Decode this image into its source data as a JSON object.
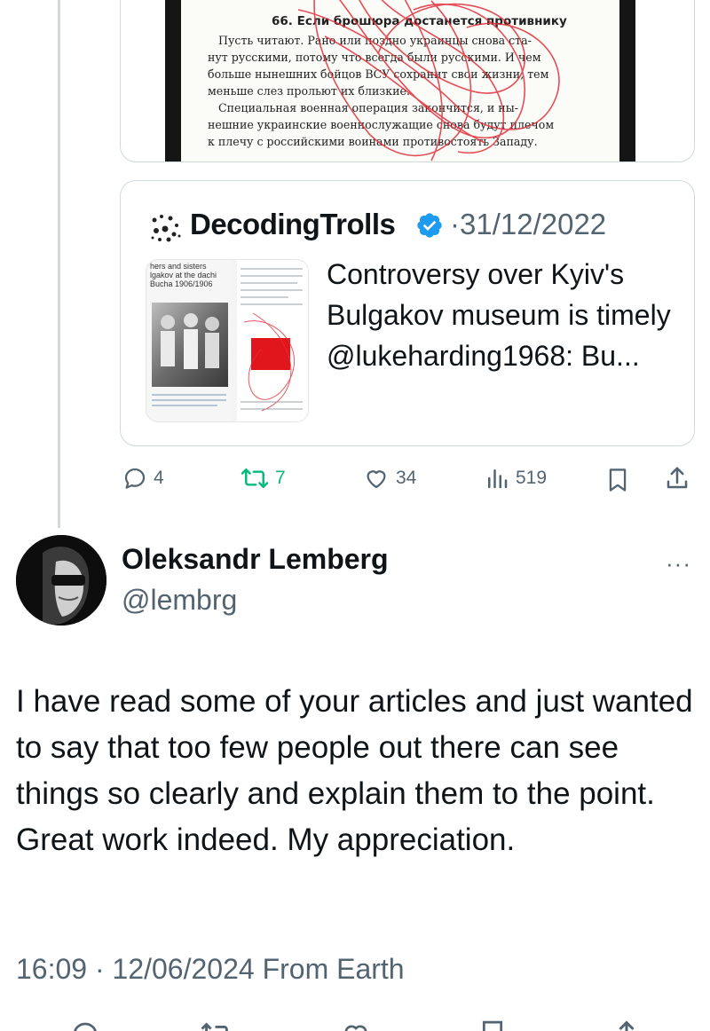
{
  "media_image": {
    "heading": "66. Если брошюра достанется противнику",
    "lines": [
      "Пусть читают. Рано или поздно украинцы снова ста-",
      "нут русскими, потому что всегда были русскими. И чем",
      "больше нынешних бойцов ВСУ сохранит свои жизни, тем",
      "меньше слез прольют их близкие.",
      "Специальная военная операция закончится, и ны-",
      "нешние украинские военнослужащие снова будут плечом",
      "к плечу с российскими воинами противостоять Западу."
    ]
  },
  "quoted_tweet": {
    "author": "DecodingTrolls",
    "separator": "·",
    "date": "31/12/2022",
    "text": "Controversy over Kyiv's Bulgakov museum is timely @lukeharding1968: Bu...",
    "thumb_caption_1": "hers and sisters",
    "thumb_caption_2": "lgakov at the dachi",
    "thumb_caption_3": "Bucha 1906/1906"
  },
  "actions": {
    "replies": "4",
    "retweets": "7",
    "likes": "34",
    "views": "519"
  },
  "reply": {
    "name": "Oleksandr Lemberg",
    "handle": "@lembrg",
    "more": "···",
    "body": "I have read some of your articles and just wanted to say that too few people out there can see things so clearly and explain them to the point.\nGreat work indeed. My appreciation.",
    "time": "16:09",
    "sep": "·",
    "date": "12/06/2024",
    "location": "From Earth"
  },
  "colors": {
    "text": "#0f1419",
    "muted": "#536471",
    "border": "#cfd9de",
    "retweet_green": "#00ba7c",
    "verified_blue": "#1d9bf0"
  }
}
